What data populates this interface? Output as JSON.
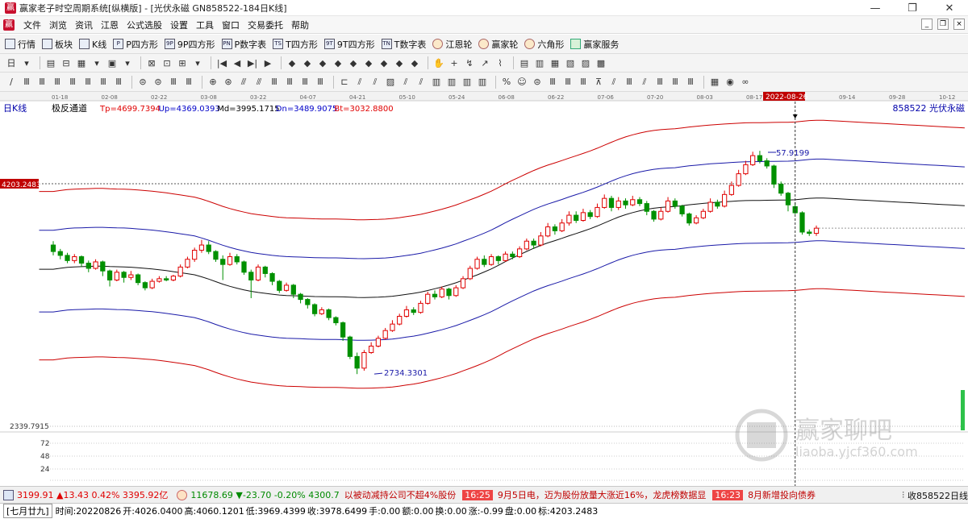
{
  "window": {
    "title": "赢家老子时空周期系统[纵横版] - [光伏永磁  GN858522-184日K线]",
    "app_icon_glyph": "赢",
    "controls": [
      "—",
      "❐",
      "✕"
    ]
  },
  "menu": {
    "items": [
      "文件",
      "浏览",
      "资讯",
      "江恩",
      "公式选股",
      "设置",
      "工具",
      "窗口",
      "交易委托",
      "帮助"
    ],
    "mdi_controls": [
      "_",
      "❐",
      "×"
    ]
  },
  "toolbar1": {
    "items": [
      {
        "label": "行情",
        "icon": "grid-icon"
      },
      {
        "label": "板块",
        "icon": "blocks-icon"
      },
      {
        "label": "K线",
        "icon": "candle-icon"
      },
      {
        "label": "P四方形",
        "icon": "P"
      },
      {
        "label": "9P四方形",
        "icon": "9P"
      },
      {
        "label": "P数字表",
        "icon": "PN"
      },
      {
        "label": "T四方形",
        "icon": "TS"
      },
      {
        "label": "9T四方形",
        "icon": "9T"
      },
      {
        "label": "T数字表",
        "icon": "TN"
      },
      {
        "label": "江恩轮",
        "icon": "wheel-icon"
      },
      {
        "label": "赢家轮",
        "icon": "wheel-icon"
      },
      {
        "label": "六角形",
        "icon": "hexagon-icon"
      },
      {
        "label": "赢家服务",
        "icon": "dollar-icon"
      }
    ]
  },
  "toolbar2": {
    "glyphs": [
      "日",
      "▾",
      "▤",
      "⊟",
      "▦",
      "▾",
      "▣",
      "▾",
      "⊠",
      "⊡",
      "⊞",
      "▾",
      "|◀",
      "◀",
      "▶|",
      "▶",
      "◆",
      "◆",
      "◆",
      "◆",
      "◆",
      "◆",
      "◆",
      "◆",
      "◆",
      "✋",
      "+",
      "↯",
      "↗",
      "⌇",
      "▤",
      "▥",
      "▦",
      "▧",
      "▨",
      "▩"
    ]
  },
  "toolbar3": {
    "glyphs": [
      "∕",
      "Ⅲ",
      "Ⅲ",
      "Ⅲ",
      "Ⅲ",
      "Ⅲ",
      "Ⅲ",
      "Ⅲ",
      "⊜",
      "⊜",
      "Ⅲ",
      "Ⅲ",
      "⊕",
      "⊛",
      "⫻",
      "⫻",
      "Ⅲ",
      "Ⅲ",
      "Ⅲ",
      "Ⅲ",
      "⊏",
      "⫽",
      "⫽",
      "▨",
      "⫽",
      "⫽",
      "▥",
      "▥",
      "▥",
      "▥",
      "%",
      "☺",
      "⊜",
      "Ⅲ",
      "Ⅲ",
      "Ⅲ",
      "⊼",
      "⫽",
      "Ⅲ",
      "⫽",
      "Ⅲ",
      "Ⅲ",
      "Ⅲ",
      "▦",
      "◉",
      "∞"
    ]
  },
  "chart_data": {
    "type": "candlestick",
    "period_label": "日K线",
    "indicator_name": "极反通道",
    "indicator_values": [
      {
        "label": "Tp=4699.7394",
        "color": "#e00000"
      },
      {
        "label": "Up=4369.0393",
        "color": "#0000c8"
      },
      {
        "label": "Md=3995.1715",
        "color": "#000000"
      },
      {
        "label": "Dn=3489.9075",
        "color": "#0000c8"
      },
      {
        "label": "Bt=3032.8800",
        "color": "#e00000"
      }
    ],
    "security": "858522  光伏永磁",
    "x_ticks": [
      "01-18",
      "02-08",
      "02-22",
      "03-08",
      "03-22",
      "04-07",
      "04-21",
      "05-10",
      "05-24",
      "06-08",
      "06-22",
      "07-06",
      "07-20",
      "08-03",
      "08-17",
      "09-14",
      "09-28",
      "10-12"
    ],
    "cursor_date": "2022-08-26",
    "cursor_price_label": "4203.2483",
    "cursor_price": 4203.2483,
    "bottom_price_label": "2339.7915",
    "bottom_price": 2339.7915,
    "annotations": [
      {
        "label": "2734.3301",
        "value": 2734.3301,
        "type": "low"
      },
      {
        "label": "4457.9199",
        "value": 4457.9199,
        "type": "high",
        "visible_label": "57.9199"
      }
    ],
    "volume_ticks": [
      72,
      48,
      24
    ],
    "y_range": [
      2300,
      4800
    ],
    "candles": [
      {
        "o": 3730,
        "c": 3680,
        "h": 3760,
        "l": 3650
      },
      {
        "o": 3680,
        "c": 3650,
        "h": 3700,
        "l": 3620
      },
      {
        "o": 3650,
        "c": 3610,
        "h": 3670,
        "l": 3590
      },
      {
        "o": 3610,
        "c": 3640,
        "h": 3660,
        "l": 3590
      },
      {
        "o": 3640,
        "c": 3590,
        "h": 3650,
        "l": 3560
      },
      {
        "o": 3590,
        "c": 3550,
        "h": 3610,
        "l": 3520
      },
      {
        "o": 3550,
        "c": 3600,
        "h": 3620,
        "l": 3540
      },
      {
        "o": 3600,
        "c": 3530,
        "h": 3610,
        "l": 3490
      },
      {
        "o": 3530,
        "c": 3460,
        "h": 3540,
        "l": 3410
      },
      {
        "o": 3460,
        "c": 3520,
        "h": 3540,
        "l": 3450
      },
      {
        "o": 3520,
        "c": 3480,
        "h": 3530,
        "l": 3440
      },
      {
        "o": 3480,
        "c": 3500,
        "h": 3530,
        "l": 3460
      },
      {
        "o": 3500,
        "c": 3440,
        "h": 3510,
        "l": 3420
      },
      {
        "o": 3440,
        "c": 3400,
        "h": 3450,
        "l": 3380
      },
      {
        "o": 3400,
        "c": 3450,
        "h": 3470,
        "l": 3390
      },
      {
        "o": 3450,
        "c": 3470,
        "h": 3490,
        "l": 3440
      },
      {
        "o": 3470,
        "c": 3460,
        "h": 3490,
        "l": 3450
      },
      {
        "o": 3460,
        "c": 3490,
        "h": 3500,
        "l": 3450
      },
      {
        "o": 3490,
        "c": 3560,
        "h": 3580,
        "l": 3480
      },
      {
        "o": 3560,
        "c": 3620,
        "h": 3640,
        "l": 3550
      },
      {
        "o": 3620,
        "c": 3690,
        "h": 3710,
        "l": 3600
      },
      {
        "o": 3690,
        "c": 3730,
        "h": 3770,
        "l": 3670
      },
      {
        "o": 3730,
        "c": 3680,
        "h": 3760,
        "l": 3660
      },
      {
        "o": 3680,
        "c": 3620,
        "h": 3690,
        "l": 3600
      },
      {
        "o": 3620,
        "c": 3580,
        "h": 3650,
        "l": 3460
      },
      {
        "o": 3580,
        "c": 3640,
        "h": 3670,
        "l": 3570
      },
      {
        "o": 3640,
        "c": 3600,
        "h": 3660,
        "l": 3580
      },
      {
        "o": 3600,
        "c": 3520,
        "h": 3610,
        "l": 3500
      },
      {
        "o": 3520,
        "c": 3460,
        "h": 3540,
        "l": 3320
      },
      {
        "o": 3460,
        "c": 3560,
        "h": 3580,
        "l": 3450
      },
      {
        "o": 3560,
        "c": 3510,
        "h": 3570,
        "l": 3480
      },
      {
        "o": 3510,
        "c": 3450,
        "h": 3520,
        "l": 3420
      },
      {
        "o": 3450,
        "c": 3380,
        "h": 3460,
        "l": 3360
      },
      {
        "o": 3380,
        "c": 3420,
        "h": 3440,
        "l": 3370
      },
      {
        "o": 3420,
        "c": 3350,
        "h": 3430,
        "l": 3320
      },
      {
        "o": 3350,
        "c": 3310,
        "h": 3360,
        "l": 3280
      },
      {
        "o": 3310,
        "c": 3270,
        "h": 3320,
        "l": 3240
      },
      {
        "o": 3270,
        "c": 3200,
        "h": 3280,
        "l": 3180
      },
      {
        "o": 3200,
        "c": 3230,
        "h": 3250,
        "l": 3190
      },
      {
        "o": 3230,
        "c": 3170,
        "h": 3240,
        "l": 3150
      },
      {
        "o": 3170,
        "c": 3130,
        "h": 3180,
        "l": 3110
      },
      {
        "o": 3130,
        "c": 3020,
        "h": 3140,
        "l": 2990
      },
      {
        "o": 3020,
        "c": 2870,
        "h": 3030,
        "l": 2850
      },
      {
        "o": 2870,
        "c": 2780,
        "h": 2900,
        "l": 2734
      },
      {
        "o": 2780,
        "c": 2900,
        "h": 2920,
        "l": 2760
      },
      {
        "o": 2900,
        "c": 2950,
        "h": 2980,
        "l": 2890
      },
      {
        "o": 2950,
        "c": 3010,
        "h": 3030,
        "l": 2940
      },
      {
        "o": 3010,
        "c": 3070,
        "h": 3090,
        "l": 3000
      },
      {
        "o": 3070,
        "c": 3120,
        "h": 3150,
        "l": 3060
      },
      {
        "o": 3120,
        "c": 3180,
        "h": 3200,
        "l": 3110
      },
      {
        "o": 3180,
        "c": 3230,
        "h": 3260,
        "l": 3170
      },
      {
        "o": 3230,
        "c": 3210,
        "h": 3250,
        "l": 3190
      },
      {
        "o": 3210,
        "c": 3280,
        "h": 3300,
        "l": 3200
      },
      {
        "o": 3280,
        "c": 3350,
        "h": 3370,
        "l": 3270
      },
      {
        "o": 3350,
        "c": 3330,
        "h": 3380,
        "l": 3310
      },
      {
        "o": 3330,
        "c": 3390,
        "h": 3410,
        "l": 3320
      },
      {
        "o": 3390,
        "c": 3340,
        "h": 3400,
        "l": 3310
      },
      {
        "o": 3340,
        "c": 3400,
        "h": 3420,
        "l": 3330
      },
      {
        "o": 3400,
        "c": 3470,
        "h": 3490,
        "l": 3390
      },
      {
        "o": 3470,
        "c": 3550,
        "h": 3570,
        "l": 3460
      },
      {
        "o": 3550,
        "c": 3620,
        "h": 3640,
        "l": 3540
      },
      {
        "o": 3620,
        "c": 3580,
        "h": 3650,
        "l": 3560
      },
      {
        "o": 3580,
        "c": 3640,
        "h": 3660,
        "l": 3570
      },
      {
        "o": 3640,
        "c": 3610,
        "h": 3650,
        "l": 3580
      },
      {
        "o": 3610,
        "c": 3660,
        "h": 3680,
        "l": 3600
      },
      {
        "o": 3660,
        "c": 3640,
        "h": 3680,
        "l": 3620
      },
      {
        "o": 3640,
        "c": 3700,
        "h": 3720,
        "l": 3630
      },
      {
        "o": 3700,
        "c": 3760,
        "h": 3780,
        "l": 3690
      },
      {
        "o": 3760,
        "c": 3730,
        "h": 3780,
        "l": 3700
      },
      {
        "o": 3730,
        "c": 3800,
        "h": 3830,
        "l": 3720
      },
      {
        "o": 3800,
        "c": 3870,
        "h": 3900,
        "l": 3790
      },
      {
        "o": 3870,
        "c": 3840,
        "h": 3890,
        "l": 3810
      },
      {
        "o": 3840,
        "c": 3900,
        "h": 3930,
        "l": 3830
      },
      {
        "o": 3900,
        "c": 3960,
        "h": 3990,
        "l": 3880
      },
      {
        "o": 3960,
        "c": 3920,
        "h": 3990,
        "l": 3900
      },
      {
        "o": 3920,
        "c": 3980,
        "h": 4010,
        "l": 3910
      },
      {
        "o": 3980,
        "c": 3950,
        "h": 4000,
        "l": 3930
      },
      {
        "o": 3950,
        "c": 4020,
        "h": 4050,
        "l": 3940
      },
      {
        "o": 4020,
        "c": 4090,
        "h": 4120,
        "l": 4010
      },
      {
        "o": 4090,
        "c": 4020,
        "h": 4110,
        "l": 3990
      },
      {
        "o": 4020,
        "c": 4070,
        "h": 4100,
        "l": 4000
      },
      {
        "o": 4070,
        "c": 4040,
        "h": 4090,
        "l": 4010
      },
      {
        "o": 4040,
        "c": 4080,
        "h": 4110,
        "l": 4030
      },
      {
        "o": 4080,
        "c": 4050,
        "h": 4100,
        "l": 4030
      },
      {
        "o": 4050,
        "c": 3990,
        "h": 4070,
        "l": 3960
      },
      {
        "o": 3990,
        "c": 3930,
        "h": 4000,
        "l": 3910
      },
      {
        "o": 3930,
        "c": 3990,
        "h": 4020,
        "l": 3920
      },
      {
        "o": 3990,
        "c": 4070,
        "h": 4100,
        "l": 3980
      },
      {
        "o": 4070,
        "c": 4030,
        "h": 4090,
        "l": 4010
      },
      {
        "o": 4030,
        "c": 3970,
        "h": 4040,
        "l": 3950
      },
      {
        "o": 3970,
        "c": 3900,
        "h": 3980,
        "l": 3880
      },
      {
        "o": 3900,
        "c": 3940,
        "h": 3960,
        "l": 3890
      },
      {
        "o": 3940,
        "c": 3990,
        "h": 4010,
        "l": 3930
      },
      {
        "o": 3990,
        "c": 4060,
        "h": 4090,
        "l": 3980
      },
      {
        "o": 4060,
        "c": 4030,
        "h": 4080,
        "l": 4010
      },
      {
        "o": 4030,
        "c": 4120,
        "h": 4150,
        "l": 4020
      },
      {
        "o": 4120,
        "c": 4190,
        "h": 4220,
        "l": 4110
      },
      {
        "o": 4190,
        "c": 4280,
        "h": 4310,
        "l": 4180
      },
      {
        "o": 4280,
        "c": 4350,
        "h": 4380,
        "l": 4270
      },
      {
        "o": 4350,
        "c": 4420,
        "h": 4450,
        "l": 4340
      },
      {
        "o": 4420,
        "c": 4380,
        "h": 4457,
        "l": 4360
      },
      {
        "o": 4380,
        "c": 4340,
        "h": 4400,
        "l": 4320
      },
      {
        "o": 4340,
        "c": 4200,
        "h": 4350,
        "l": 4170
      },
      {
        "o": 4200,
        "c": 4130,
        "h": 4220,
        "l": 4110
      },
      {
        "o": 4130,
        "c": 4040,
        "h": 4140,
        "l": 3990
      },
      {
        "o": 4026,
        "c": 3979,
        "h": 4060,
        "l": 3969
      },
      {
        "o": 3979,
        "c": 3830,
        "h": 3990,
        "l": 3810
      },
      {
        "o": 3830,
        "c": 3820,
        "h": 3850,
        "l": 3800
      },
      {
        "o": 3820,
        "c": 3860,
        "h": 3880,
        "l": 3800
      }
    ]
  },
  "statusbar1": {
    "sh_value": "3199.91",
    "sh_change": "▲13.43",
    "sh_pct": "0.42%",
    "sh_amount": "3395.92亿",
    "sz_value": "11678.69",
    "sz_change": "▼-23.70",
    "sz_pct": "-0.20%",
    "sz_amount": "4300.7",
    "news1": "以被动减持公司不超4%股份",
    "time1": "16:25",
    "news2": "9月5日电，迈为股份放量大涨近16%，龙虎榜数据显",
    "time2": "16:23",
    "news3": "8月新增投向债券",
    "right_label": "收858522日线"
  },
  "statusbar2": {
    "lunar": "[七月廿九]",
    "time": "时间:20220826",
    "open": "开:4026.0400",
    "high": "高:4060.1201",
    "low": "低:3969.4399",
    "close": "收:3978.6499",
    "hand": "手:0.00",
    "amount": "额:0.00",
    "turnover": "换:0.00",
    "change": "涨:-0.99",
    "pan": "盘:0.00",
    "mark": "标:4203.2483"
  },
  "watermark": {
    "brand": "赢家聊吧",
    "url": "liaoba.yjcf360.com"
  }
}
